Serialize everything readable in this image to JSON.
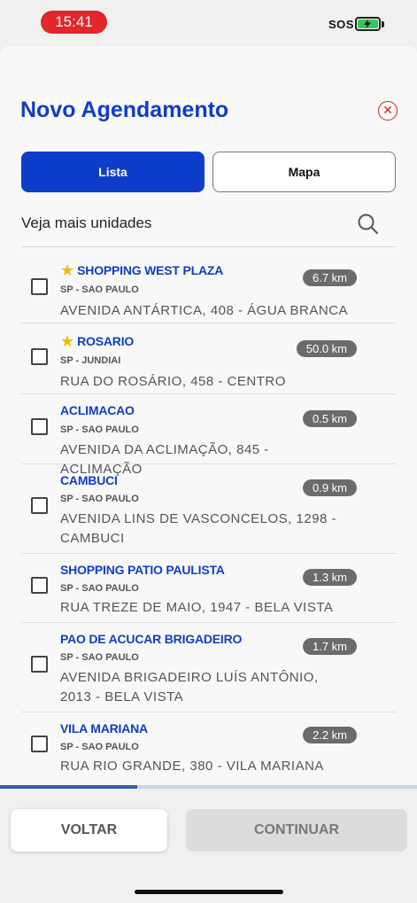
{
  "status_bar": {
    "time": "15:41",
    "sos": "SOS"
  },
  "header": {
    "title": "Novo Agendamento"
  },
  "tabs": [
    {
      "label": "Lista",
      "active": true
    },
    {
      "label": "Mapa",
      "active": false
    }
  ],
  "search": {
    "label": "Veja mais unidades"
  },
  "units": [
    {
      "name": "SHOPPING WEST PLAZA",
      "favorite": true,
      "city": "SP - SAO PAULO",
      "address": "AVENIDA ANTÁRTICA, 408 - ÁGUA BRANCA",
      "distance": "6.7 km"
    },
    {
      "name": "ROSARIO",
      "favorite": true,
      "city": "SP - JUNDIAI",
      "address": "RUA DO ROSÁRIO, 458 - CENTRO",
      "distance": "50.0 km"
    },
    {
      "name": "ACLIMACAO",
      "favorite": false,
      "city": "SP - SAO PAULO",
      "address": "AVENIDA DA ACLIMAÇÃO, 845 - ACLIMAÇÃO",
      "distance": "0.5 km"
    },
    {
      "name": "CAMBUCI",
      "favorite": false,
      "city": "SP - SAO PAULO",
      "address": "AVENIDA LINS DE VASCONCELOS, 1298 - CAMBUCI",
      "distance": "0.9 km"
    },
    {
      "name": "SHOPPING PATIO PAULISTA",
      "favorite": false,
      "city": "SP - SAO PAULO",
      "address": "RUA TREZE DE MAIO, 1947 - BELA VISTA",
      "distance": "1.3 km"
    },
    {
      "name": "PAO DE ACUCAR BRIGADEIRO",
      "favorite": false,
      "city": "SP - SAO PAULO",
      "address": "AVENIDA BRIGADEIRO LUÍS ANTÔNIO, 2013 - BELA VISTA",
      "distance": "1.7 km"
    },
    {
      "name": "VILA MARIANA",
      "favorite": false,
      "city": "SP - SAO PAULO",
      "address": "RUA RIO GRANDE, 380 - VILA MARIANA",
      "distance": "2.2 km"
    }
  ],
  "progress": {
    "fraction": 0.33
  },
  "footer": {
    "back_label": "VOLTAR",
    "continue_label": "CONTINUAR"
  },
  "colors": {
    "accent": "#0d3dc9",
    "title": "#0f3ec4",
    "star": "#f5b900",
    "close": "#c8261f",
    "badge": "#6b6b6b"
  }
}
